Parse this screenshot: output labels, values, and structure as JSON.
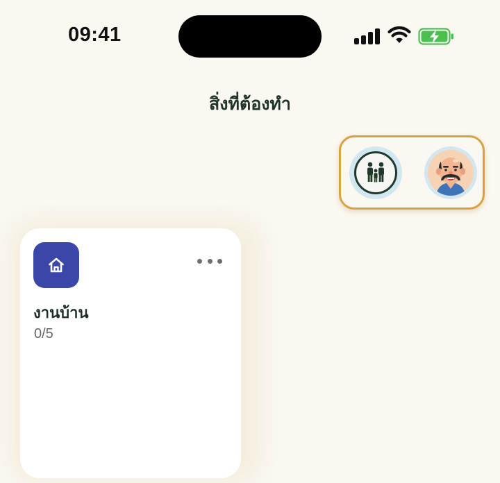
{
  "status_bar": {
    "time": "09:41",
    "battery_color": "#4CC04F"
  },
  "header": {
    "title": "สิ่งที่ต้องทำ"
  },
  "member_switcher": {
    "members": [
      {
        "id": "family",
        "icon": "family-icon"
      },
      {
        "id": "person",
        "icon": "avatar-bald-man-mustache"
      }
    ],
    "highlight_color": "#D9A23E"
  },
  "task_cards": [
    {
      "icon": "home-icon",
      "icon_bg": "#3B47A8",
      "title": "งานบ้าน",
      "progress": "0/5"
    }
  ]
}
